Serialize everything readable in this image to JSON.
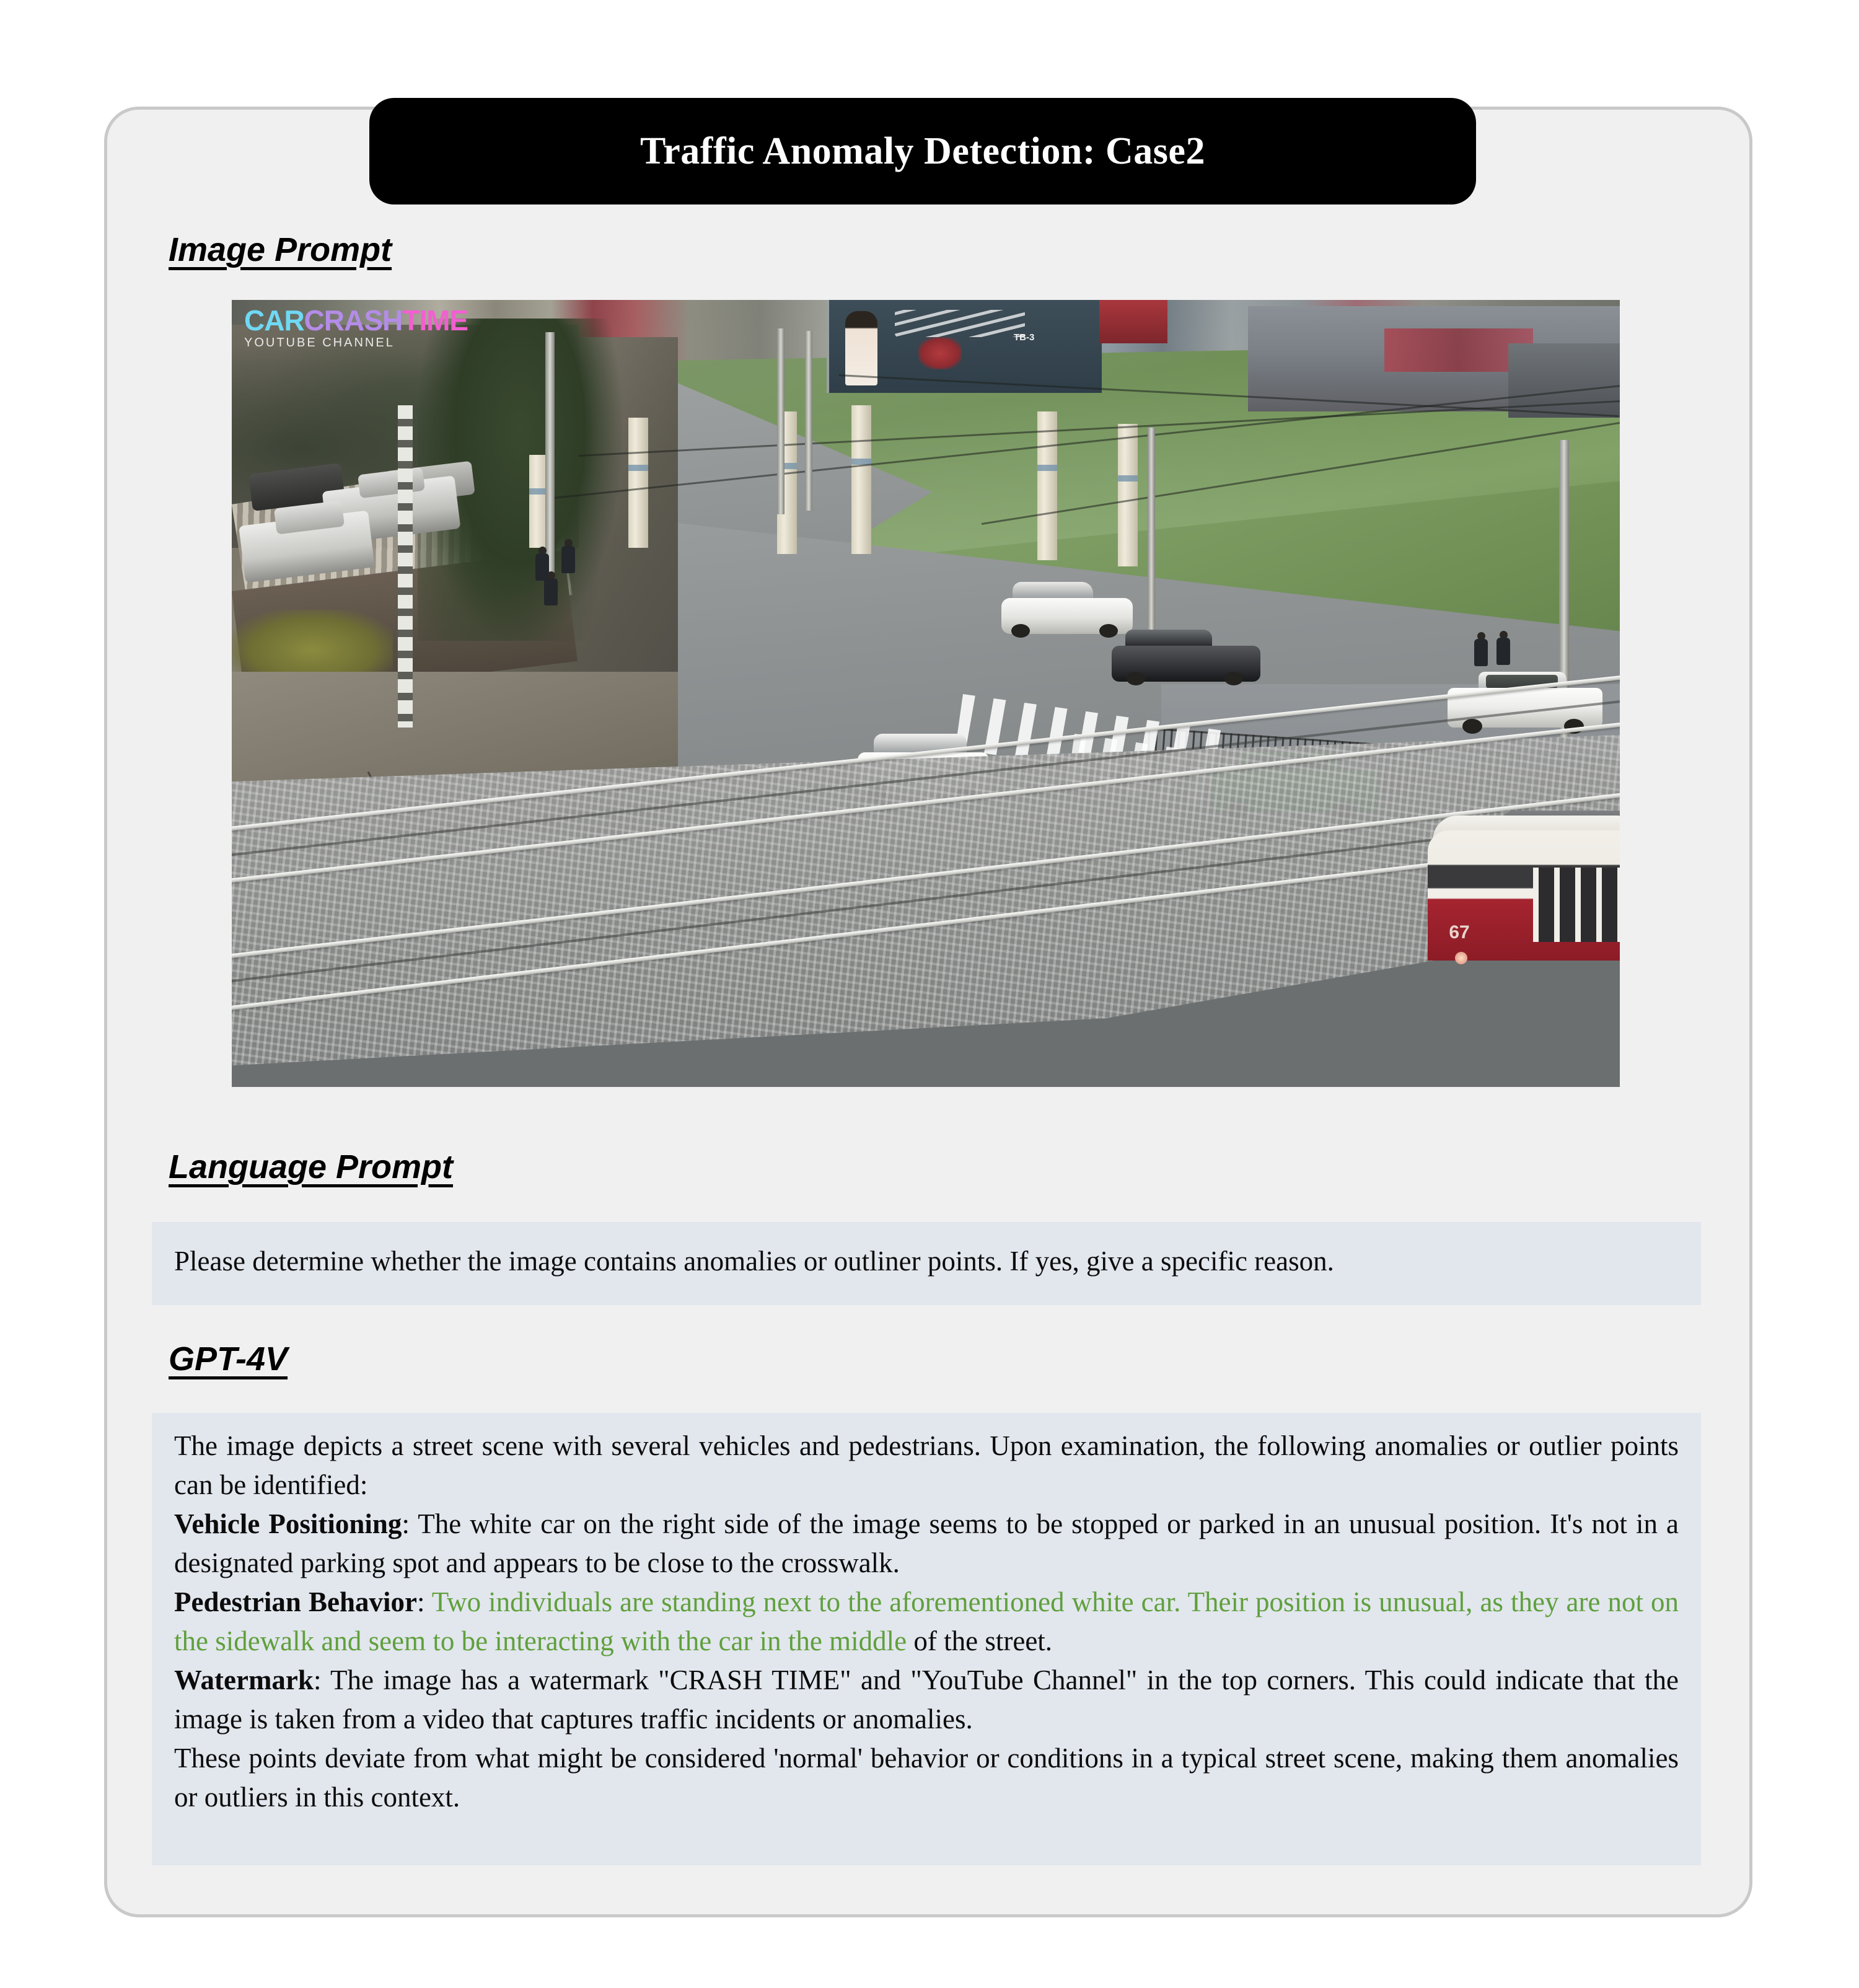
{
  "title": "Traffic Anomaly Detection: Case2",
  "sections": {
    "image_prompt_heading": "Image Prompt",
    "language_prompt_heading": "Language Prompt",
    "model_heading": "GPT-4V"
  },
  "language_prompt": "Please determine whether the image contains anomalies or outliner points. If yes, give a specific reason.",
  "response": {
    "intro": "The image depicts a street scene with several vehicles and pedestrians. Upon examination, the following anomalies or outlier points can be identified:",
    "item1_label": "Vehicle Positioning",
    "item1_sep": ": ",
    "item1_text": "The white car on the right side of the image seems to be stopped or parked in an unusual position. It's not in a designated parking spot and appears to be close to the crosswalk.",
    "item2_label": "Pedestrian Behavior",
    "item2_sep": ": ",
    "item2_green": "Two individuals are standing next to the aforementioned white car. Their position is unusual, as they are not on the sidewalk and seem to be interacting with the car in the middle",
    "item2_tail": " of the street.",
    "item3_label": "Watermark",
    "item3_sep": ": ",
    "item3_text": "The image has a watermark \"CRASH TIME\" and \"YouTube Channel\" in the top corners. This could indicate that the image is taken from a video that captures traffic incidents or anomalies.",
    "outro": "These points deviate from what might be considered 'normal' behavior or conditions in a typical street scene, making them anomalies or outliers in this context."
  },
  "photo": {
    "watermark_part1": "CAR",
    "watermark_part2": "CRASH",
    "watermark_part3": "TIME",
    "watermark_sub": "YOUTUBE CHANNEL",
    "billboard_text": "TB-3",
    "tram_number": "67",
    "scene_description": "Elevated CCTV view of a street intersection with tram tracks, a green Lada, a white Lada stopped near the curb with two pedestrians beside it, a white SUV, a dark sedan, a white hatchback, a red-and-cream tram, parked cars on a hillside behind a stone wall, a grass field with concrete pillars, and a billboard."
  },
  "colors": {
    "title_bar_bg": "#000000",
    "title_bar_text": "#ffffff",
    "card_bg": "#f0f0f0",
    "card_border": "#c9c9c9",
    "textbox_bg": "#e2e6ed",
    "highlight_green": "#5fa03c",
    "body_text": "#0c0c0c"
  }
}
